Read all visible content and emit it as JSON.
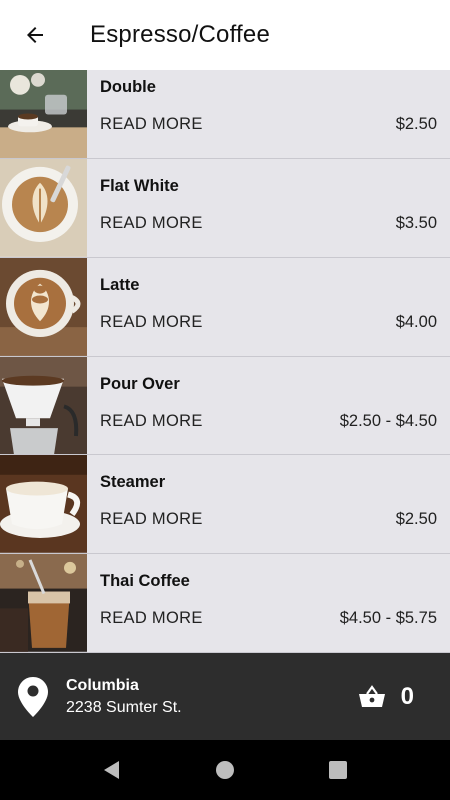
{
  "header": {
    "title": "Espresso/Coffee",
    "back_icon": "arrow-left-icon"
  },
  "items": [
    {
      "name": "Double",
      "read_more": "READ MORE",
      "price": "$2.50"
    },
    {
      "name": "Flat White",
      "read_more": "READ MORE",
      "price": "$3.50"
    },
    {
      "name": "Latte",
      "read_more": "READ MORE",
      "price": "$4.00"
    },
    {
      "name": "Pour Over",
      "read_more": "READ MORE",
      "price": "$2.50 - $4.50"
    },
    {
      "name": "Steamer",
      "read_more": "READ MORE",
      "price": "$2.50"
    },
    {
      "name": "Thai Coffee",
      "read_more": "READ MORE",
      "price": "$4.50 - $5.75"
    }
  ],
  "location": {
    "name": "Columbia",
    "address": "2238 Sumter St.",
    "icon": "map-pin-icon"
  },
  "cart": {
    "count": "0",
    "icon": "basket-icon"
  },
  "colors": {
    "list_bg": "#e6e5ea",
    "bottom_bar": "#2d2d2d",
    "nav_bar": "#000000"
  }
}
